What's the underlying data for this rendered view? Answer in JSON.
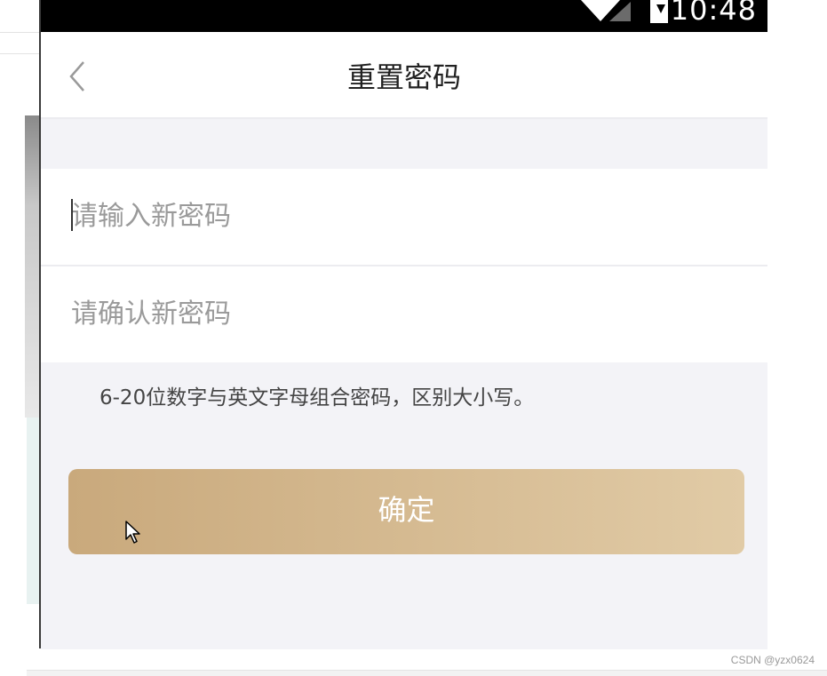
{
  "status_bar": {
    "time": "10:48"
  },
  "header": {
    "title": "重置密码"
  },
  "form": {
    "new_password_placeholder": "请输入新密码",
    "confirm_password_placeholder": "请确认新密码"
  },
  "hint": "6-20位数字与英文字母组合密码，区别大小写。",
  "confirm_button_label": "确定",
  "watermark": "CSDN @yzx0624",
  "colors": {
    "accent_start": "#c9a97c",
    "accent_end": "#e1cba6",
    "background": "#f3f3f7"
  },
  "icons": {
    "back": "chevron-left-icon",
    "wifi": "wifi-icon",
    "signal": "signal-icon",
    "battery": "battery-charging-icon",
    "pointer": "mouse-cursor-icon"
  }
}
